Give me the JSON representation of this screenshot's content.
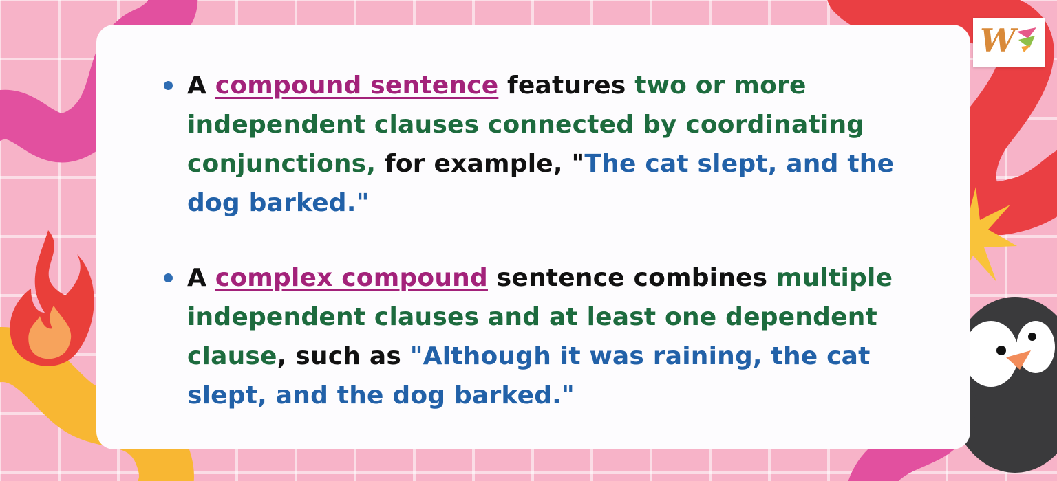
{
  "bullets": [
    {
      "lead": "A ",
      "term": "compound sentence",
      "mid": " features ",
      "highlight": "two or more independent clauses connected by coordinating conjunctions,",
      "connector": " for example, \"",
      "example": "The cat slept, and the dog barked.\""
    },
    {
      "lead": "A ",
      "term": "complex compound",
      "mid": " sentence combines ",
      "highlight": "multiple independent clauses and at least one dependent clause",
      "connector": ", such as ",
      "example": "\"Although it was raining, the cat slept, and the dog barked.\""
    }
  ],
  "logo": {
    "letter": "W"
  },
  "colors": {
    "term": "#a3227a",
    "highlight": "#1d6b3e",
    "example": "#2261a8",
    "bullet_dot": "#2f6db3",
    "background": "#f7b3c8"
  }
}
